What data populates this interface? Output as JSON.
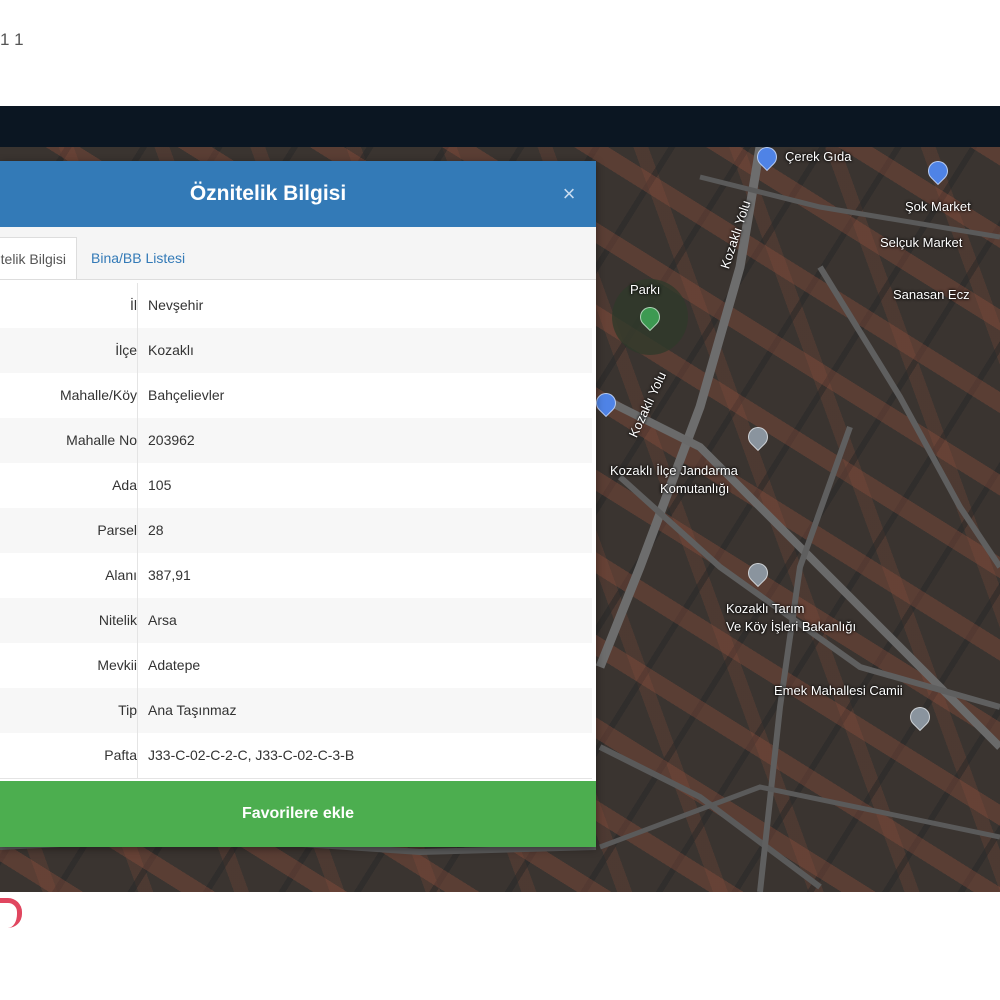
{
  "page": {
    "top_label": "1 1"
  },
  "dialog": {
    "title": "Öznitelik Bilgisi",
    "close_symbol": "×",
    "tabs": [
      {
        "label": "Öznitelik Bilgisi",
        "active": true
      },
      {
        "label": "Bina/BB Listesi",
        "active": false
      }
    ],
    "rows": [
      {
        "key": "İl",
        "value": "Nevşehir"
      },
      {
        "key": "İlçe",
        "value": "Kozaklı"
      },
      {
        "key": "Mahalle/Köy",
        "value": "Bahçelievler"
      },
      {
        "key": "Mahalle No",
        "value": "203962"
      },
      {
        "key": "Ada",
        "value": "105"
      },
      {
        "key": "Parsel",
        "value": "28"
      },
      {
        "key": "Alanı",
        "value": "387,91"
      },
      {
        "key": "Nitelik",
        "value": "Arsa"
      },
      {
        "key": "Mevkii",
        "value": "Adatepe"
      },
      {
        "key": "Tip",
        "value": "Ana Taşınmaz"
      },
      {
        "key": "Pafta",
        "value": "J33-C-02-C-2-C, J33-C-02-C-3-B"
      }
    ],
    "fav_button": "Favorilere ekle"
  },
  "map": {
    "labels": [
      {
        "text": "Çerek Gıda"
      },
      {
        "text": "Şok Market"
      },
      {
        "text": "Selçuk Market"
      },
      {
        "text": "Sanasan Ecz"
      },
      {
        "text": "Kozaklı Yolu"
      },
      {
        "text": "Kozaklı Yolu"
      },
      {
        "text": "Kozaklı İlçe Jandarma"
      },
      {
        "text": "Komutanlığı"
      },
      {
        "text": "Kozaklı Tarım"
      },
      {
        "text": "Ve Köy İşleri Bakanlığı"
      },
      {
        "text": "Emek Mahallesi Camii"
      },
      {
        "text": "Parkı"
      }
    ]
  }
}
